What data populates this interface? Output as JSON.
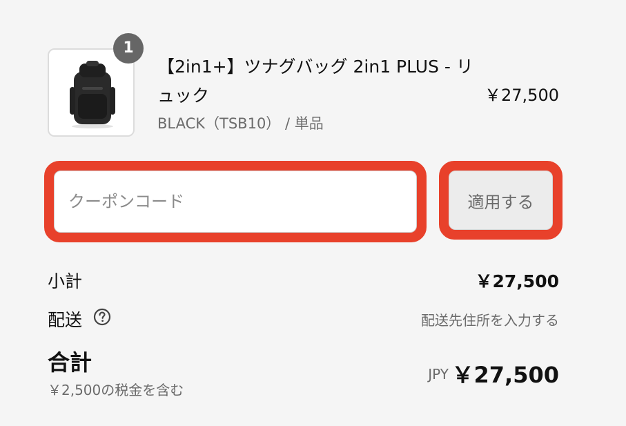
{
  "product": {
    "quantity": "1",
    "title": "【2in1+】ツナグバッグ 2in1 PLUS - リュック",
    "variant": "BLACK（TSB10） / 単品",
    "price": "￥27,500",
    "image_icon": "backpack-image"
  },
  "coupon": {
    "placeholder": "クーポンコード",
    "value": "",
    "apply_label": "適用する",
    "highlight_color": "#e8412b"
  },
  "summary": {
    "subtotal_label": "小計",
    "subtotal_value": "￥27,500",
    "shipping_label": "配送",
    "shipping_icon": "question-circle-icon",
    "shipping_value": "配送先住所を入力する",
    "total_label": "合計",
    "tax_note": "￥2,500の税金を含む",
    "currency": "JPY",
    "total_value": "￥27,500"
  }
}
